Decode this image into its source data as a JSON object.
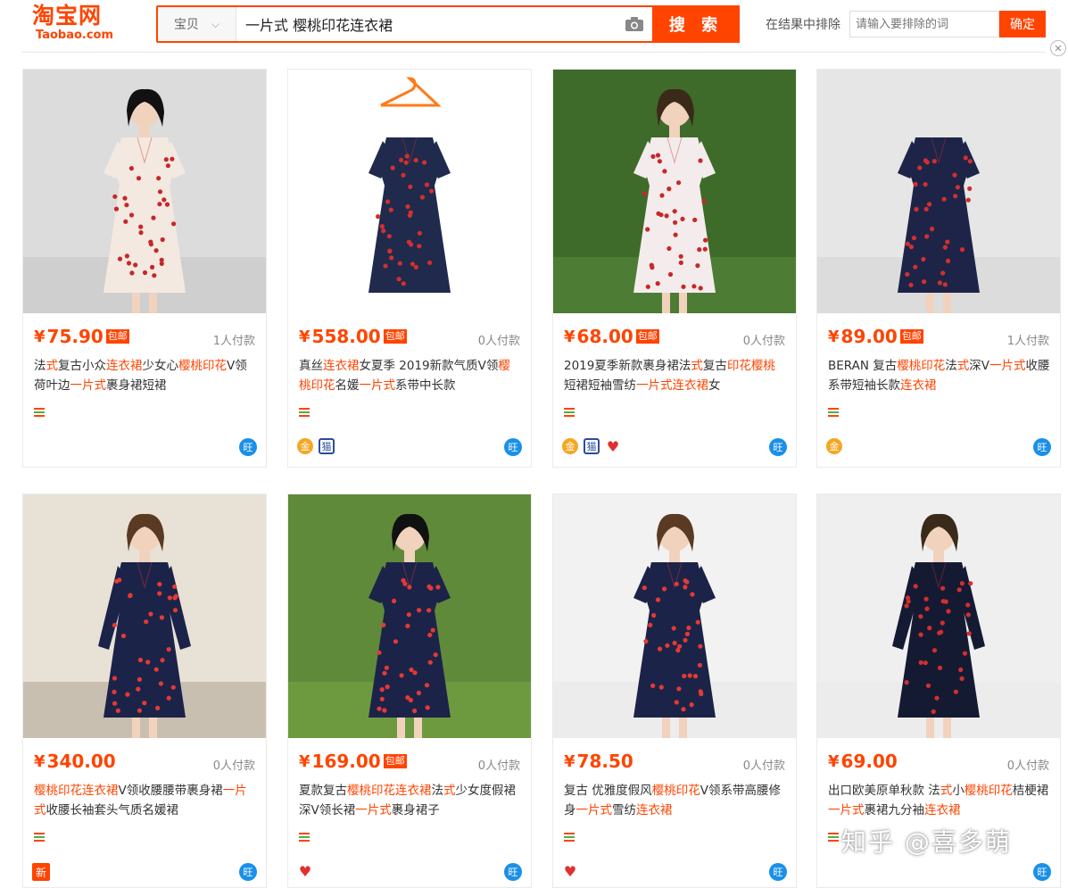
{
  "header": {
    "logo_cn": "淘宝网",
    "logo_en": "Taobao.com",
    "category": "宝贝",
    "query": "一片式 樱桃印花连衣裙",
    "search_label": "搜 索",
    "exclude_label": "在结果中排除",
    "exclude_placeholder": "请输入要排除的词",
    "exclude_button": "确定"
  },
  "colors": {
    "accent": "#ff4400",
    "wangwang": "#1a90e8"
  },
  "products": [
    {
      "price": "75.90",
      "baoyou": "包邮",
      "sales": "1人付款",
      "title_parts": [
        [
          "法"
        ],
        [
          "式",
          "hl"
        ],
        [
          "复古小众"
        ],
        [
          "连衣裙",
          "hl"
        ],
        [
          "少女心"
        ],
        [
          "樱桃印花",
          "hl"
        ],
        [
          "V领荷叶边"
        ],
        [
          "一片式",
          "hl"
        ],
        [
          "裹身裙短裙"
        ]
      ],
      "badges": []
    },
    {
      "price": "558.00",
      "baoyou": "包邮",
      "sales": "0人付款",
      "title_parts": [
        [
          "真丝"
        ],
        [
          "连衣裙",
          "hl"
        ],
        [
          "女夏季 2019新款气质V领"
        ],
        [
          "樱桃印花",
          "hl"
        ],
        [
          "名媛"
        ],
        [
          "一片式",
          "hl"
        ],
        [
          "系带中长款"
        ]
      ],
      "badges": [
        "gold-medal-icon",
        "tmall-cat-icon"
      ]
    },
    {
      "price": "68.00",
      "baoyou": "包邮",
      "sales": "0人付款",
      "title_parts": [
        [
          "2019夏季新款裹身裙法"
        ],
        [
          "式",
          "hl"
        ],
        [
          "复古"
        ],
        [
          "印花樱桃",
          "hl"
        ],
        [
          "短裙短袖雪纺"
        ],
        [
          "一片式连衣裙",
          "hl"
        ],
        [
          "女"
        ]
      ],
      "badges": [
        "gold-medal-icon",
        "tmall-cat-icon",
        "heart-icon"
      ]
    },
    {
      "price": "89.00",
      "baoyou": "包邮",
      "sales": "1人付款",
      "title_parts": [
        [
          "BERAN 复古"
        ],
        [
          "樱桃印花",
          "hl"
        ],
        [
          "法"
        ],
        [
          "式",
          "hl"
        ],
        [
          "深V"
        ],
        [
          "一片式",
          "hl"
        ],
        [
          "收腰系带短袖长款"
        ],
        [
          "连衣裙",
          "hl"
        ]
      ],
      "badges": [
        "gold-medal-icon"
      ]
    },
    {
      "price": "340.00",
      "baoyou": "",
      "sales": "0人付款",
      "title_parts": [
        [
          "樱桃印花连衣裙",
          "hl"
        ],
        [
          "V领收腰腰带裹身裙"
        ],
        [
          "一片式",
          "hl"
        ],
        [
          "收腰长袖套头气质名媛裙"
        ]
      ],
      "badges": [
        "new-icon"
      ]
    },
    {
      "price": "169.00",
      "baoyou": "包邮",
      "sales": "0人付款",
      "title_parts": [
        [
          "夏款复古"
        ],
        [
          "樱桃印花连衣裙",
          "hl"
        ],
        [
          "法"
        ],
        [
          "式",
          "hl"
        ],
        [
          "少女度假裙深V领长裙"
        ],
        [
          "一片式",
          "hl"
        ],
        [
          "裹身裙子"
        ]
      ],
      "badges": [
        "heart-icon"
      ]
    },
    {
      "price": "78.50",
      "baoyou": "",
      "sales": "0人付款",
      "title_parts": [
        [
          "复古 优雅度假风"
        ],
        [
          "樱桃印花",
          "hl"
        ],
        [
          "V领系带高腰修身"
        ],
        [
          "一片式",
          "hl"
        ],
        [
          "雪纺"
        ],
        [
          "连衣裙",
          "hl"
        ]
      ],
      "badges": [
        "heart-icon"
      ]
    },
    {
      "price": "69.00",
      "baoyou": "",
      "sales": "0人付款",
      "title_parts": [
        [
          "出口欧美原单秋款 法"
        ],
        [
          "式",
          "hl"
        ],
        [
          "小"
        ],
        [
          "樱桃印花",
          "hl"
        ],
        [
          "桔梗裙"
        ],
        [
          "一片式",
          "hl"
        ],
        [
          "裹裙九分袖"
        ],
        [
          "连衣裙",
          "hl"
        ]
      ],
      "badges": []
    }
  ],
  "watermark": "知乎 @喜多萌"
}
